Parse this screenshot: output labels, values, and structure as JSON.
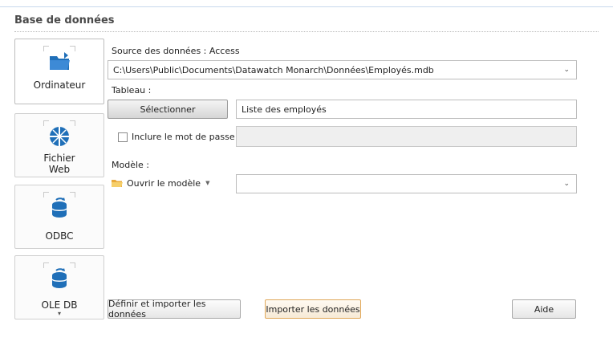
{
  "section": {
    "title": "Base de données"
  },
  "sources": [
    {
      "label": "Ordinateur",
      "icon": "folder-open-icon"
    },
    {
      "label": "Fichier\nWeb",
      "icon": "web-globe-icon"
    },
    {
      "label": "ODBC",
      "icon": "database-icon"
    },
    {
      "label": "OLE DB",
      "icon": "database-icon",
      "arrow": "▾"
    }
  ],
  "form": {
    "source_label": "Source des données :",
    "source_type": "Access",
    "path": "C:\\Users\\Public\\Documents\\Datawatch Monarch\\Données\\Employés.mdb",
    "table_label": "Tableau :",
    "select_button": "Sélectionner",
    "table_value": "Liste des employés",
    "password_checkbox_label": "Inclure le mot de passe",
    "password_checked": false,
    "password_value": "",
    "model_label": "Modèle :",
    "open_model_label": "Ouvrir le modèle",
    "model_value": ""
  },
  "footer": {
    "define_import": "Définir et importer les données",
    "import": "Importer les données",
    "help": "Aide"
  },
  "colors": {
    "accent_blue": "#1f6fb8",
    "folder_yellow": "#f0b43c",
    "primary_border": "#e0a85a"
  }
}
